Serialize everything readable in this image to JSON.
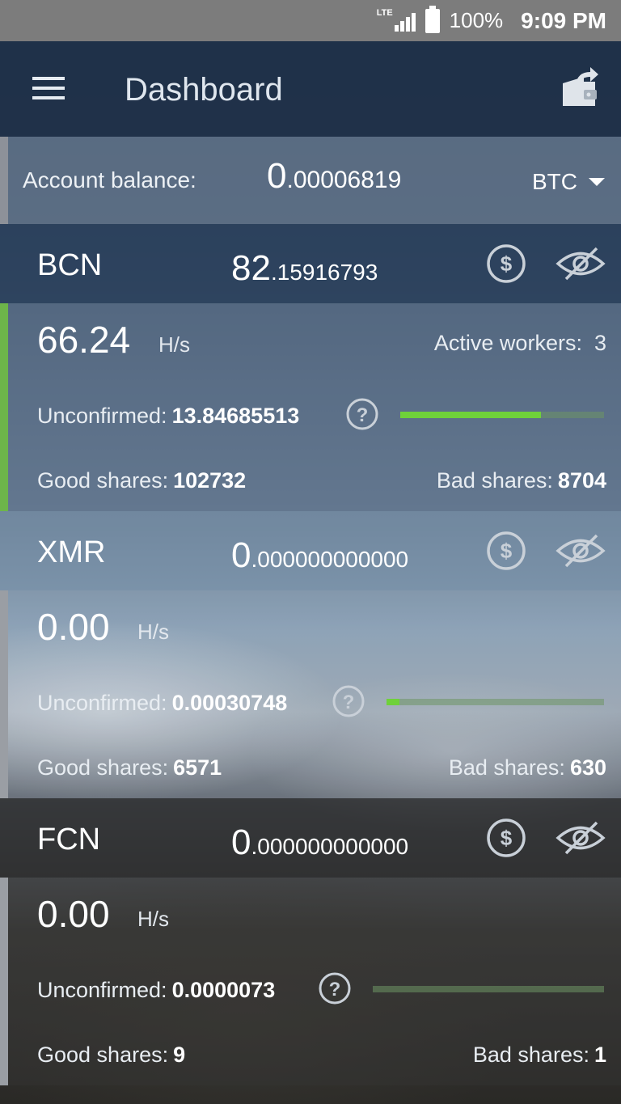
{
  "status_bar": {
    "network": "LTE",
    "battery": "100%",
    "time": "9:09 PM"
  },
  "app_bar": {
    "title": "Dashboard"
  },
  "balance": {
    "label": "Account balance:",
    "value_int": "0",
    "value_dec": ".00006819",
    "currency": "BTC"
  },
  "coins": [
    {
      "symbol": "BCN",
      "balance_int": "82",
      "balance_dec": ".15916793",
      "hashrate": "66.24",
      "unit": "H/s",
      "workers_label": "Active workers:",
      "workers": "3",
      "unconfirmed_label": "Unconfirmed:",
      "unconfirmed": "13.84685513",
      "progress": 0.69,
      "good_label": "Good shares:",
      "good": "102732",
      "bad_label": "Bad shares:",
      "bad": "8704"
    },
    {
      "symbol": "XMR",
      "balance_int": "0",
      "balance_dec": ".000000000000",
      "hashrate": "0.00",
      "unit": "H/s",
      "unconfirmed_label": "Unconfirmed:",
      "unconfirmed": "0.00030748",
      "progress": 0.06,
      "good_label": "Good shares:",
      "good": "6571",
      "bad_label": "Bad shares:",
      "bad": "630"
    },
    {
      "symbol": "FCN",
      "balance_int": "0",
      "balance_dec": ".000000000000",
      "hashrate": "0.00",
      "unit": "H/s",
      "unconfirmed_label": "Unconfirmed:",
      "unconfirmed": "0.0000073",
      "progress": 0.0,
      "good_label": "Good shares:",
      "good": "9",
      "bad_label": "Bad shares:",
      "bad": "1"
    }
  ],
  "colors": {
    "progress_fill": "#6fd13a",
    "active_accent": "#6db54a"
  }
}
